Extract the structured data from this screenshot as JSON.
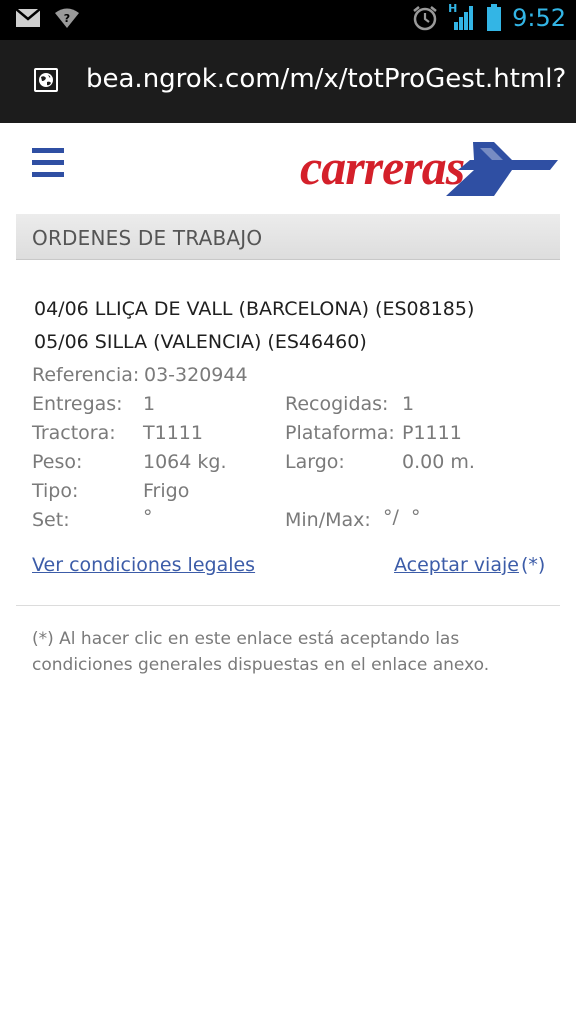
{
  "status_bar": {
    "time": "9:52",
    "network_label": "H",
    "icons": [
      "gmail-icon",
      "wifi-question-icon",
      "alarm-icon",
      "signal-icon",
      "battery-icon"
    ]
  },
  "browser": {
    "url": "bea.ngrok.com/m/x/totProGest.html?"
  },
  "header": {
    "logo_text": "carreras",
    "menu_icon": "hamburger-menu-icon",
    "brand_color": "#d4202a",
    "accent_color": "#2f4fa3"
  },
  "section": {
    "title": "ORDENES DE TRABAJO"
  },
  "order": {
    "route_lines": [
      "04/06 LLIÇA DE VALL (BARCELONA) (ES08185)",
      "05/06 SILLA (VALENCIA) (ES46460)"
    ],
    "reference_label": "Referencia:",
    "reference_value": "03-320944",
    "fields_left": [
      {
        "label": "Entregas:",
        "value": "1"
      },
      {
        "label": "Tractora:",
        "value": "T1111"
      },
      {
        "label": "Peso:",
        "value": "1064 kg."
      },
      {
        "label": "Tipo:",
        "value": "Frigo"
      },
      {
        "label": "Set:",
        "value": "°"
      }
    ],
    "fields_right": [
      {
        "label": "Recogidas:",
        "value": "1"
      },
      {
        "label": "Plataforma:",
        "value": "P1111"
      },
      {
        "label": "Largo:",
        "value": "0.00 m."
      },
      {
        "label": "Min/Max:",
        "value": "°/  °"
      }
    ]
  },
  "links": {
    "legal": "Ver condiciones legales",
    "accept": "Aceptar viaje",
    "accept_note": "(*)"
  },
  "footnote": "(*) Al hacer clic en este enlace está aceptando las condiciones generales dispuestas en el enlace anexo."
}
